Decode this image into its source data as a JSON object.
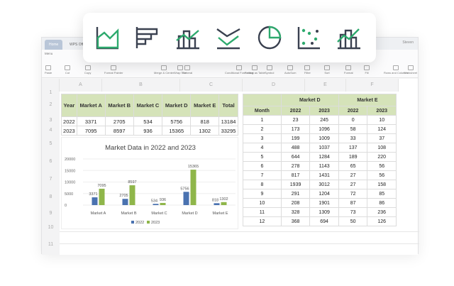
{
  "window": {
    "tabs": [
      "Home",
      "WPS Office"
    ],
    "user": "Steven",
    "menu": "Menu"
  },
  "ribbon": [
    "Paste",
    "Cut",
    "Copy",
    "Format Painter",
    "Merge & Center",
    "Wrap Text",
    "General",
    "Conditional Formatting",
    "Format as Table",
    "Symbol",
    "AutoSum",
    "Filter",
    "Sort",
    "Format",
    "Fill",
    "Rows and Columns",
    "Worksheet"
  ],
  "floating_icons": [
    "area-chart-icon",
    "bar-chart-icon",
    "combo-chart-icon",
    "line-chart-icon",
    "pie-chart-icon",
    "scatter-chart-icon",
    "column-line-chart-icon"
  ],
  "columns": [
    "A",
    "B",
    "C",
    "D",
    "E",
    "F"
  ],
  "rows": [
    "1",
    "2",
    "3",
    "4",
    "5",
    "6",
    "7",
    "8",
    "9",
    "10",
    "11"
  ],
  "left_table": {
    "headers": [
      "Year",
      "Market A",
      "Market B",
      "Market C",
      "Market D",
      "Market E",
      "Total"
    ],
    "rows": [
      [
        "2022",
        "3371",
        "2705",
        "534",
        "5756",
        "818",
        "13184"
      ],
      [
        "2023",
        "7095",
        "8597",
        "936",
        "15365",
        "1302",
        "33295"
      ]
    ]
  },
  "right_table": {
    "groups": [
      "Market D",
      "Market E"
    ],
    "subheaders": [
      "Month",
      "2022",
      "2023",
      "2022",
      "2023"
    ],
    "rows": [
      [
        "1",
        "23",
        "245",
        "0",
        "10"
      ],
      [
        "2",
        "173",
        "1096",
        "58",
        "124"
      ],
      [
        "3",
        "199",
        "1009",
        "33",
        "37"
      ],
      [
        "4",
        "488",
        "1037",
        "137",
        "108"
      ],
      [
        "5",
        "644",
        "1284",
        "189",
        "220"
      ],
      [
        "6",
        "278",
        "1143",
        "65",
        "56"
      ],
      [
        "7",
        "817",
        "1431",
        "27",
        "56"
      ],
      [
        "8",
        "1939",
        "3012",
        "27",
        "158"
      ],
      [
        "9",
        "291",
        "1204",
        "72",
        "85"
      ],
      [
        "10",
        "208",
        "1901",
        "87",
        "86"
      ],
      [
        "11",
        "328",
        "1309",
        "73",
        "236"
      ],
      [
        "12",
        "368",
        "694",
        "50",
        "126"
      ]
    ]
  },
  "chart_data": {
    "type": "bar",
    "title": "Market Data in 2022 and 2023",
    "categories": [
      "Market A",
      "Market B",
      "Market C",
      "Market D",
      "Market E"
    ],
    "series": [
      {
        "name": "2022",
        "values": [
          3371,
          2705,
          534,
          5756,
          818
        ],
        "color": "#4a72b0"
      },
      {
        "name": "2023",
        "values": [
          7095,
          8597,
          936,
          15365,
          1302
        ],
        "color": "#8fb64a"
      }
    ],
    "ylim": [
      0,
      20000
    ],
    "yticks": [
      "0",
      "5000",
      "10000",
      "15000",
      "20000"
    ],
    "grid": true,
    "legend": "bottom"
  }
}
